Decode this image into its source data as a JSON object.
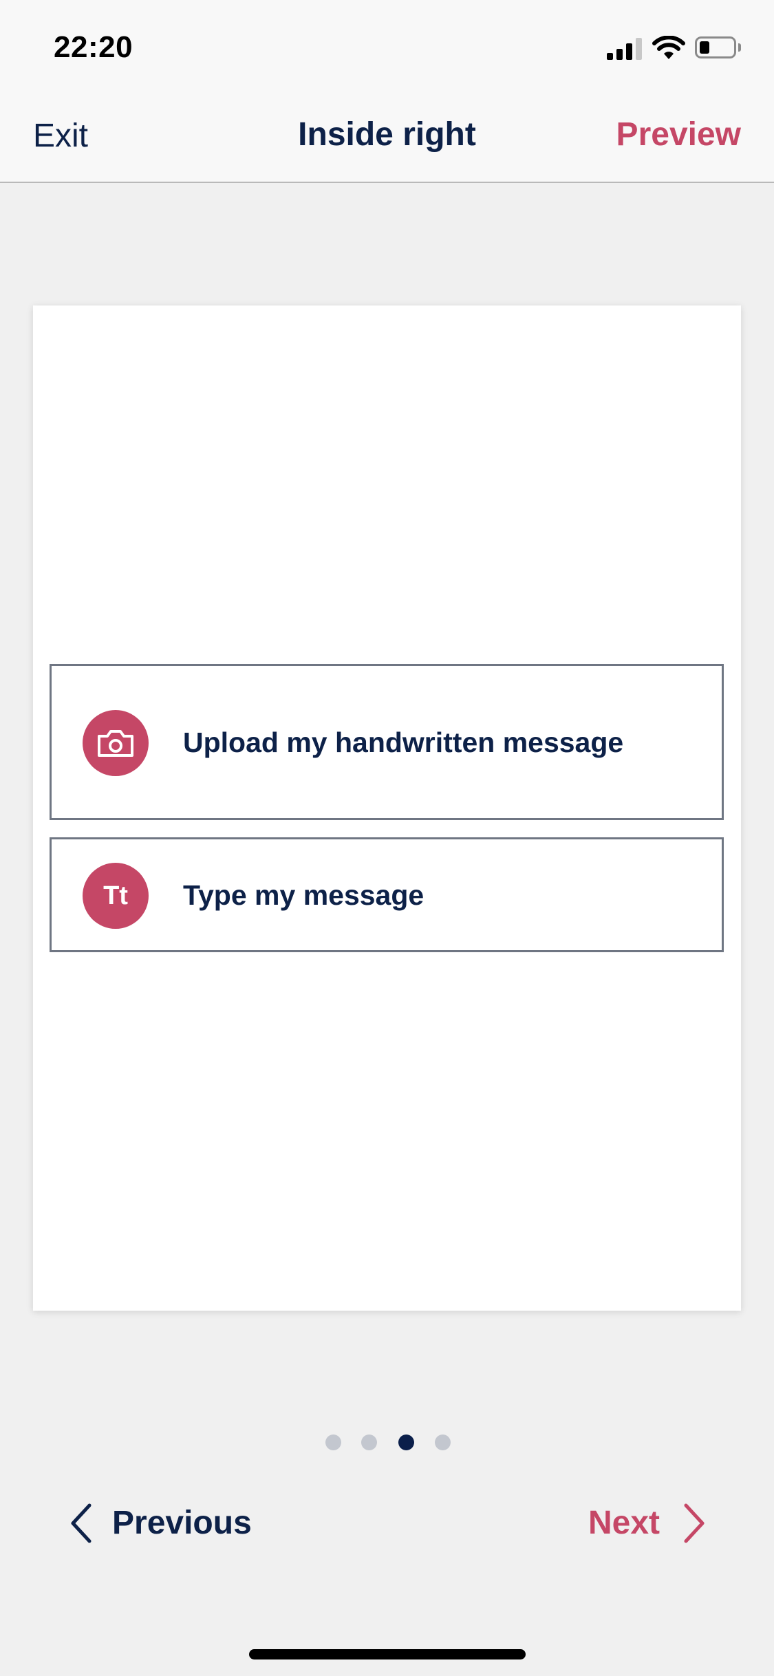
{
  "status_bar": {
    "time": "22:20",
    "signal_bars_filled": 3,
    "signal_bars_total": 4,
    "wifi": "wifi-icon",
    "battery_level": 0.3
  },
  "header": {
    "exit_label": "Exit",
    "title": "Inside right",
    "preview_label": "Preview"
  },
  "card": {
    "options": [
      {
        "icon": "camera-icon",
        "label": "Upload my handwritten message"
      },
      {
        "icon": "text-icon",
        "icon_text": "Tt",
        "label": "Type my message"
      }
    ]
  },
  "pagination": {
    "total": 4,
    "current": 3
  },
  "footer": {
    "previous_label": "Previous",
    "next_label": "Next"
  },
  "colors": {
    "navy": "#0d2148",
    "accent": "#c54766",
    "dot_inactive": "#c3c7cf",
    "dot_active": "#0b1f4a",
    "option_border": "#6f7683"
  }
}
